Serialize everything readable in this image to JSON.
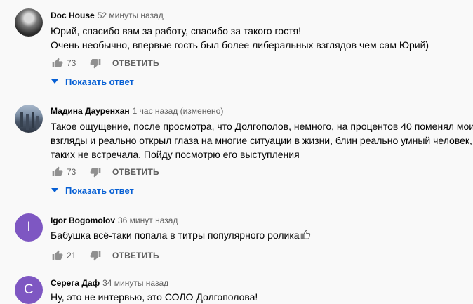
{
  "comments": [
    {
      "author": "Doc House",
      "time": "52 минуты назад",
      "avatar_letter": "",
      "lines": [
        "Юрий, спасибо вам за работу, спасибо за такого гостя!",
        "Очень необычно, впервые гость был более либеральных взглядов чем сам Юрий)"
      ],
      "likes": "73",
      "reply_label": "ОТВЕТИТЬ",
      "show_replies_label": "Показать ответ"
    },
    {
      "author": "Мадина Дауренхан",
      "time": "1 час назад (изменено)",
      "avatar_letter": "",
      "lines": [
        "Такое ощущение, после просмотра, что Долгополов, немного, на процентов 40 поменял мои",
        "взгляды и реально открыл глаза на многие ситуации в жизни, блин реально умный человек,",
        "таких не встречала. Пойду посмотрю его выступления"
      ],
      "likes": "73",
      "reply_label": "ОТВЕТИТЬ",
      "show_replies_label": "Показать ответ"
    },
    {
      "author": "Igor Bogomolov",
      "time": "36 минут назад",
      "avatar_letter": "I",
      "avatar_color": "#7e57c2",
      "lines": [
        "Бабушка всё-таки попала в титры популярного ролика"
      ],
      "likes": "21",
      "reply_label": "ОТВЕТИТЬ"
    },
    {
      "author": "Серега Даф",
      "time": "34 минуты назад",
      "avatar_letter": "C",
      "avatar_color": "#7e57c2",
      "lines": [
        "Ну, это не интервью, это СОЛО Долгополова!"
      ]
    }
  ],
  "colors": {
    "background": "#f9f9f9",
    "link": "#065fd4",
    "secondary_text": "#606060",
    "icon": "#909090"
  }
}
